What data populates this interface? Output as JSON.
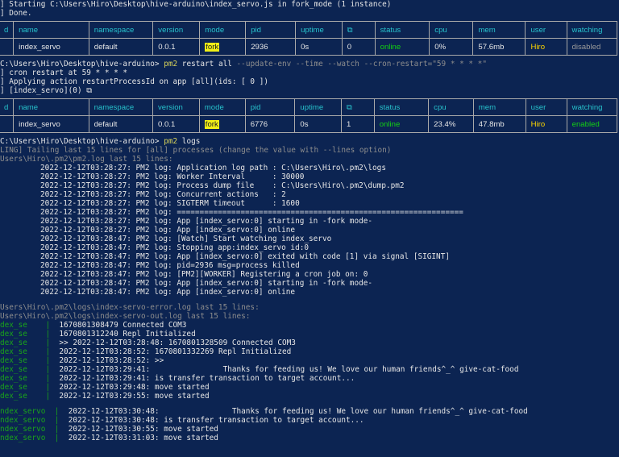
{
  "top": {
    "line1": "] Starting C:\\Users\\Hiro\\Desktop\\hive-arduino\\index_servo.js in fork_mode (1 instance)",
    "line2": "] Done."
  },
  "table_headers": [
    "d",
    "name",
    "namespace",
    "version",
    "mode",
    "pid",
    "uptime",
    "⧉",
    "status",
    "cpu",
    "mem",
    "user",
    "watching"
  ],
  "table1_row": [
    "",
    "index_servo",
    "default",
    "0.0.1",
    "fork",
    "2936",
    "0s",
    "0",
    "online",
    "0%",
    "57.6mb",
    "Hiro",
    "disabled"
  ],
  "cmd1": {
    "prompt": "C:\\Users\\Hiro\\Desktop\\hive-arduino>",
    "cmd": "pm2",
    "args": " restart all",
    "flags": " --update-env --time --watch --cron-restart=\"59 * * * *\""
  },
  "restart_lines": [
    "] cron restart at 59 * * * *",
    "] Applying action restartProcessId on app [all](ids: [ 0 ])",
    "] [index_servo](0) ⧉"
  ],
  "table2_row": [
    "",
    "index_servo",
    "default",
    "0.0.1",
    "fork",
    "6776",
    "0s",
    "1",
    "online",
    "23.4%",
    "47.8mb",
    "Hiro",
    "enabled"
  ],
  "cmd2": {
    "prompt": "C:\\Users\\Hiro\\Desktop\\hive-arduino>",
    "cmd": "pm2",
    "args": " logs"
  },
  "tailing": "LING] Tailing last 15 lines for [all] processes (change the value with --lines option)",
  "pm2_log_header": "Users\\Hiro\\.pm2\\pm2.log last 15 lines:",
  "pm2_log_lines": [
    "2022-12-12T03:28:27: PM2 log: Application log path : C:\\Users\\Hiro\\.pm2\\logs",
    "2022-12-12T03:28:27: PM2 log: Worker Interval      : 30000",
    "2022-12-12T03:28:27: PM2 log: Process dump file    : C:\\Users\\Hiro\\.pm2\\dump.pm2",
    "2022-12-12T03:28:27: PM2 log: Concurrent actions   : 2",
    "2022-12-12T03:28:27: PM2 log: SIGTERM timeout      : 1600",
    "2022-12-12T03:28:27: PM2 log: ===============================================================",
    "2022-12-12T03:28:27: PM2 log: App [index_servo:0] starting in -fork mode-",
    "2022-12-12T03:28:27: PM2 log: App [index_servo:0] online",
    "2022-12-12T03:28:47: PM2 log: [Watch] Start watching index_servo",
    "2022-12-12T03:28:47: PM2 log: Stopping app:index_servo id:0",
    "2022-12-12T03:28:47: PM2 log: App [index_servo:0] exited with code [1] via signal [SIGINT]",
    "2022-12-12T03:28:47: PM2 log: pid=2936 msg=process killed",
    "2022-12-12T03:28:47: PM2 log: [PM2][WORKER] Registering a cron job on: 0",
    "2022-12-12T03:28:47: PM2 log: App [index_servo:0] starting in -fork mode-",
    "2022-12-12T03:28:47: PM2 log: App [index_servo:0] online"
  ],
  "error_log_header": "Users\\Hiro\\.pm2\\logs\\index-servo-error.log last 15 lines:",
  "out_log_header": "Users\\Hiro\\.pm2\\logs\\index-servo-out.log last 15 lines:",
  "out_prefix": "dex_se",
  "out_lines": [
    "1670801308479 Connected COM3",
    "1670801312240 Repl Initialized",
    ">> 2022-12-12T03:28:48: 1670801328509 Connected COM3",
    "2022-12-12T03:28:52: 1670801332269 Repl Initialized",
    "2022-12-12T03:28:52: >>",
    "2022-12-12T03:29:41:                Thanks for feeding us! We love our human friends^_^ give-cat-food",
    "2022-12-12T03:29:41: is transfer transaction to target account...",
    "2022-12-12T03:29:48: move started",
    "2022-12-12T03:29:55: move started"
  ],
  "live_prefix": "ndex_servo",
  "live_lines": [
    "2022-12-12T03:30:48:                Thanks for feeding us! We love our human friends^_^ give-cat-food",
    "2022-12-12T03:30:48: is transfer transaction to target account...",
    "2022-12-12T03:30:55: move started",
    "2022-12-12T03:31:03: move started"
  ]
}
